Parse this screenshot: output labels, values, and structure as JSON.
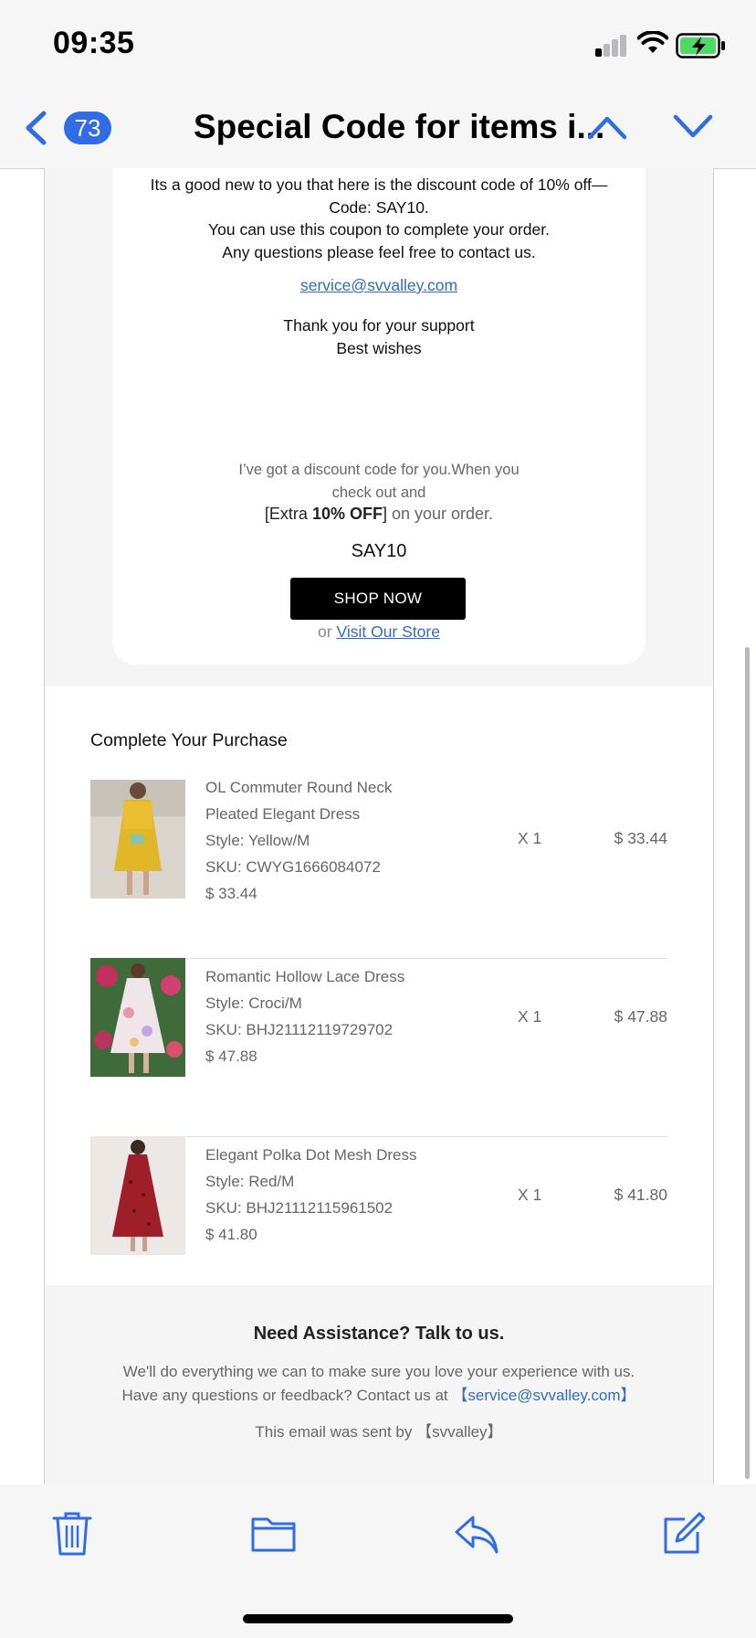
{
  "status_bar": {
    "time": "09:35"
  },
  "nav": {
    "badge_count": "73",
    "title": "Special Code for items i..."
  },
  "card": {
    "lines": [
      "Its a good new to you that here is the discount code of 10% off—",
      "Code: SAY10.",
      "You can use this coupon to complete your order.",
      "Any questions please feel free to contact us."
    ],
    "email": "service@svvalley.com",
    "thanks": [
      "Thank you for your support",
      "Best wishes"
    ],
    "promo_line1": "I’ve got a discount code for you.When you check out and",
    "promo_open": "[Extra ",
    "promo_bold": "10% OFF",
    "promo_close": "]",
    "promo_tail": " on your order.",
    "code": "SAY10",
    "shop_now": "SHOP NOW",
    "or_text": "or ",
    "visit_store": "Visit Our Store"
  },
  "purchase": {
    "heading": "Complete Your Purchase",
    "items": [
      {
        "name_line1": "OL Commuter Round Neck",
        "name_line2": "Pleated Elegant Dress",
        "style": "Style: Yellow/M",
        "sku": "SKU: CWYG1666084072",
        "price_line": "$ 33.44",
        "qty": "X 1",
        "total": "$ 33.44"
      },
      {
        "name_line1": "Romantic Hollow Lace Dress",
        "style": "Style: Croci/M",
        "sku": "SKU: BHJ21112119729702",
        "price_line": "$ 47.88",
        "qty": "X 1",
        "total": "$ 47.88"
      },
      {
        "name_line1": "Elegant Polka Dot Mesh Dress",
        "style": "Style: Red/M",
        "sku": "SKU: BHJ21112115961502",
        "price_line": "$ 41.80",
        "qty": "X 1",
        "total": "$ 41.80"
      }
    ]
  },
  "footer": {
    "heading": "Need Assistance? Talk to us.",
    "line1": "We'll do everything we can to make sure you love your experience with us.",
    "line2": "Have any questions or feedback? Contact us at ",
    "contact": "【service@svvalley.com】",
    "sent_by": "This email was sent by 【svvalley】"
  },
  "toolbar": {
    "icons": [
      "trash-icon",
      "folder-icon",
      "reply-icon",
      "compose-icon"
    ]
  },
  "colors": {
    "accent": "#2f6ce5",
    "link": "#2f6ebd",
    "battery_green": "#4cd964"
  }
}
